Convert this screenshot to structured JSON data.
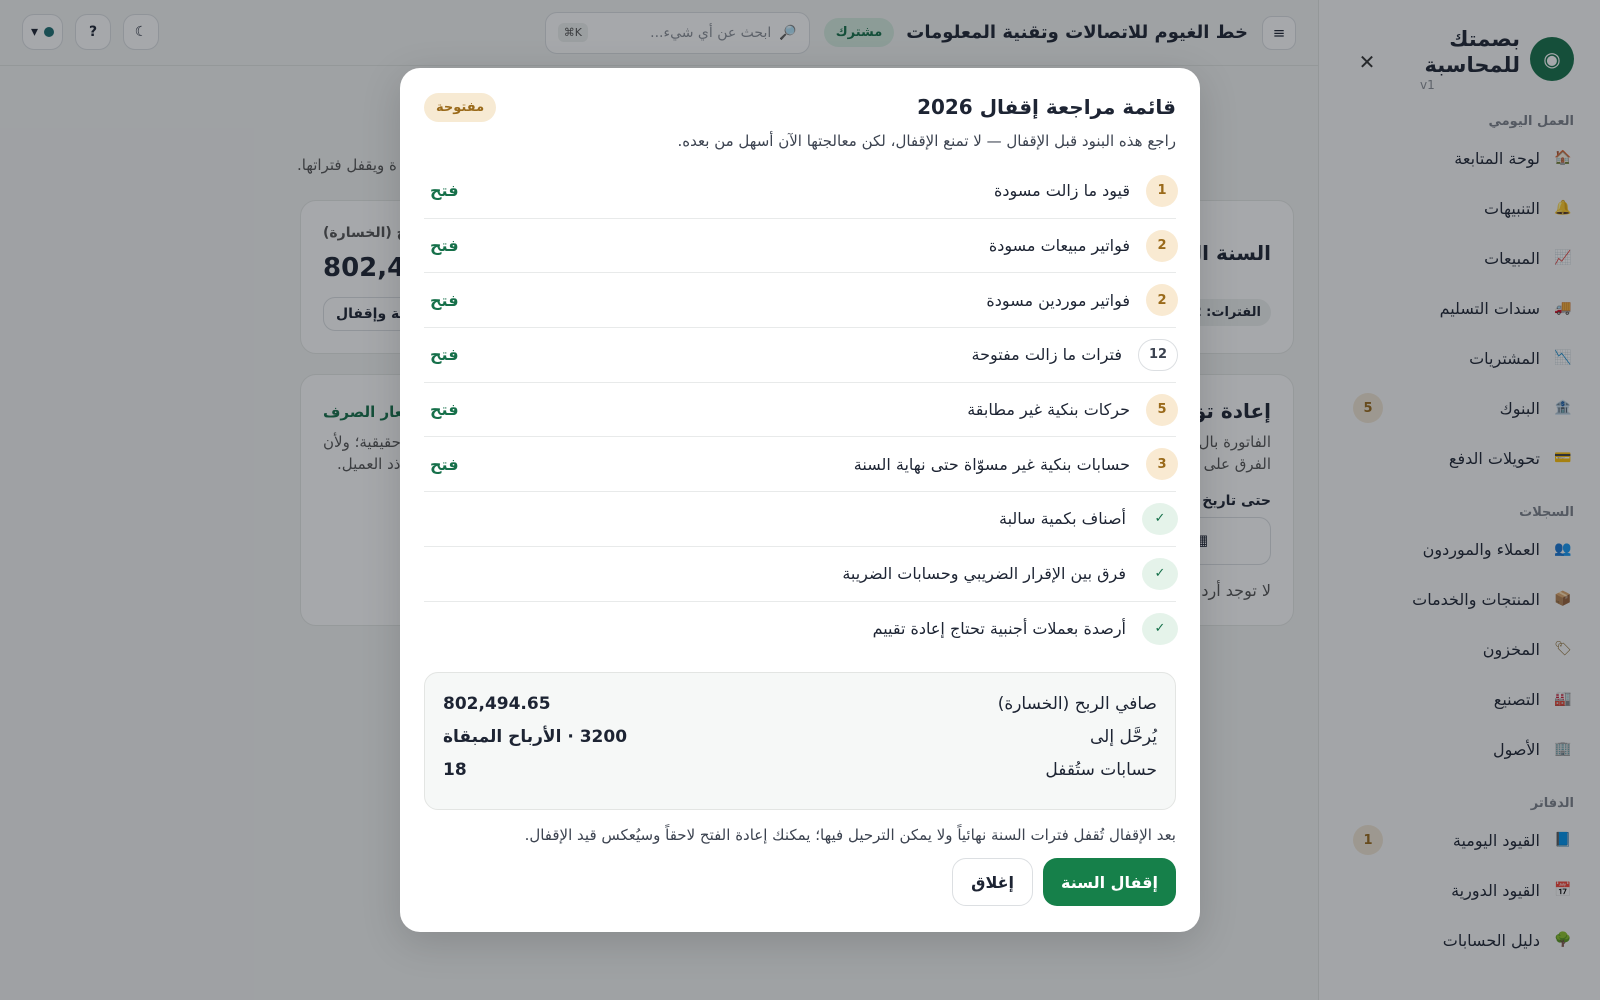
{
  "sidebar": {
    "brand": "بصمتك للمحاسبة",
    "version": "v1",
    "sections": [
      {
        "title": "العمل اليومي",
        "items": [
          {
            "label": "لوحة المتابعة",
            "icon": "🏠",
            "badge": ""
          },
          {
            "label": "التنبيهات",
            "icon": "🔔",
            "badge": ""
          },
          {
            "label": "المبيعات",
            "icon": "📈",
            "badge": ""
          },
          {
            "label": "سندات التسليم",
            "icon": "🚚",
            "badge": ""
          },
          {
            "label": "المشتريات",
            "icon": "📉",
            "badge": ""
          },
          {
            "label": "البنوك",
            "icon": "🏦",
            "badge": "5"
          },
          {
            "label": "تحويلات الدفع",
            "icon": "💳",
            "badge": ""
          }
        ]
      },
      {
        "title": "السجلات",
        "items": [
          {
            "label": "العملاء والموردون",
            "icon": "👥",
            "badge": ""
          },
          {
            "label": "المنتجات والخدمات",
            "icon": "📦",
            "badge": ""
          },
          {
            "label": "المخزون",
            "icon": "🏷",
            "badge": ""
          },
          {
            "label": "التصنيع",
            "icon": "🏭",
            "badge": ""
          },
          {
            "label": "الأصول",
            "icon": "🏢",
            "badge": ""
          }
        ]
      },
      {
        "title": "الدفاتر",
        "items": [
          {
            "label": "القيود اليومية",
            "icon": "📘",
            "badge": "1"
          },
          {
            "label": "القيود الدورية",
            "icon": "📅",
            "badge": ""
          },
          {
            "label": "دليل الحسابات",
            "icon": "🌳",
            "badge": ""
          }
        ]
      }
    ]
  },
  "topbar": {
    "menu_icon": "≡",
    "company": "خط الغيوم للاتصالات وتقنية المعلومات",
    "subscription": "مشترك",
    "search_placeholder": "ابحث عن أي شيء...",
    "shortcut": "K⌘",
    "help": "?",
    "theme_icon": "☾",
    "org_caret": "▾"
  },
  "modal": {
    "title": "قائمة مراجعة إقفال 2026",
    "status": "مفتوحة",
    "description": "راجع هذه البنود قبل الإقفال — لا تمنع الإقفال، لكن معالجتها الآن أسهل من بعده.",
    "items": [
      {
        "count": "1",
        "label": "قيود ما زالت مسودة",
        "link": "فتح",
        "kind": "warn"
      },
      {
        "count": "2",
        "label": "فواتير مبيعات مسودة",
        "link": "فتح",
        "kind": "warn"
      },
      {
        "count": "2",
        "label": "فواتير موردين مسودة",
        "link": "فتح",
        "kind": "warn"
      },
      {
        "count": "12",
        "label": "فترات ما زالت مفتوحة",
        "link": "فتح",
        "kind": "gray"
      },
      {
        "count": "5",
        "label": "حركات بنكية غير مطابقة",
        "link": "فتح",
        "kind": "warn"
      },
      {
        "count": "3",
        "label": "حسابات بنكية غير مسوّاة حتى نهاية السنة",
        "link": "فتح",
        "kind": "warn"
      },
      {
        "count": "✓",
        "label": "أصناف بكمية سالبة",
        "link": "",
        "kind": "ok"
      },
      {
        "count": "✓",
        "label": "فرق بين الإقرار الضريبي وحسابات الضريبة",
        "link": "",
        "kind": "ok"
      },
      {
        "count": "✓",
        "label": "أرصدة بعملات أجنبية تحتاج إعادة تقييم",
        "link": "",
        "kind": "ok"
      }
    ],
    "summary": [
      {
        "label": "صافي الربح (الخسارة)",
        "value": "802,494.65"
      },
      {
        "label": "يُرحَّل إلى",
        "value": "3200 · الأرباح المبقاة"
      },
      {
        "label": "حسابات ستُقفل",
        "value": "18"
      }
    ],
    "warning": "بعد الإقفال تُقفل فترات السنة نهائياً ولا يمكن الترحيل فيها؛ يمكنك إعادة الفتح لاحقاً وسيُعكس قيد الإقفال.",
    "close_label": "إغلاق",
    "confirm_label": "إقفال السنة"
  },
  "background": {
    "note": "ة ويقفل فتراتها.",
    "card1_title": "السنة ال",
    "card1_metric_label": "ربح (الخسارة)",
    "card1_metric": "802,49",
    "card1_periods": "الفترات: 2",
    "card1_button": "عة وإقفال",
    "card2_title": "إعادة تق",
    "card2_link": "سعار الصرف",
    "card2_text1": "الفاتورة بال",
    "card2_text2": "الفرق على",
    "card2_text3": "حقيقية؛ ولأن",
    "card2_text4": "ذد العميل.",
    "card2_date_label": "حتى تاريخ",
    "card2_empty": "لا توجد أرد"
  }
}
